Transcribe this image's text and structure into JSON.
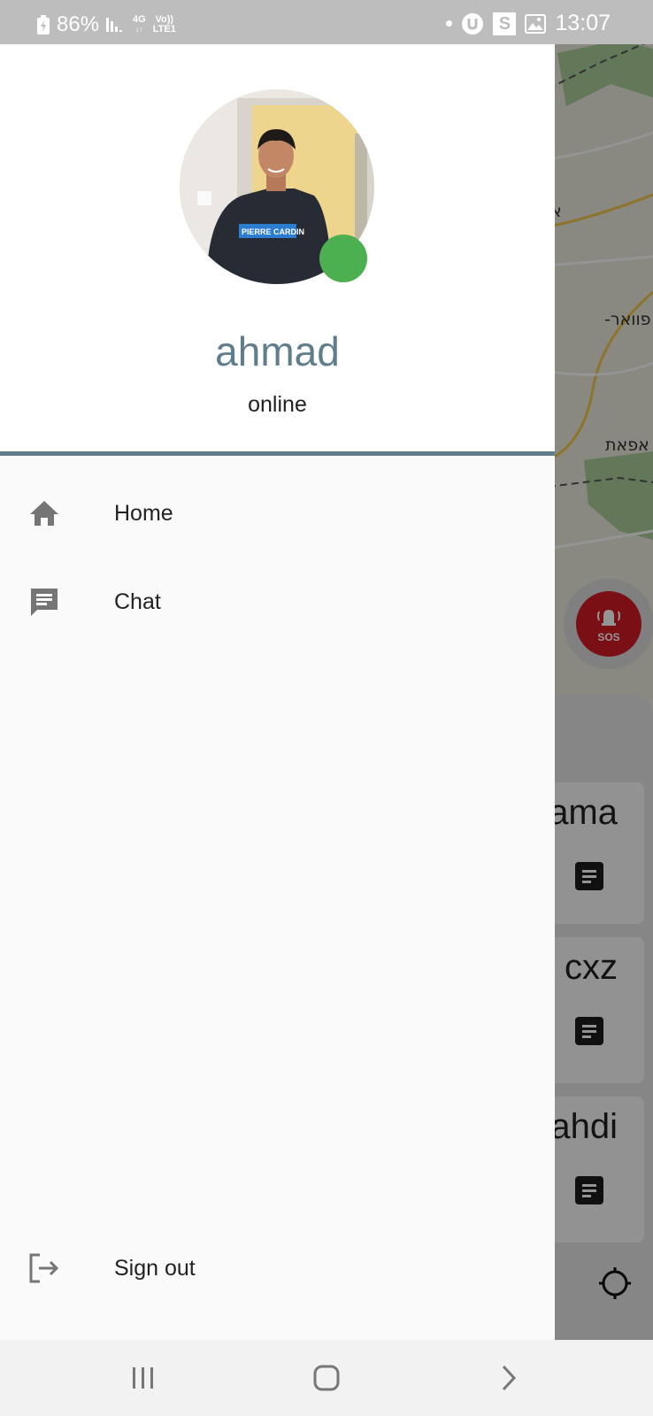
{
  "status_bar": {
    "battery_percent": "86%",
    "network": "4G",
    "volte": "Vo))",
    "lte": "LTE1",
    "time": "13:07",
    "icons": [
      "battery-charging-icon",
      "signal-icon",
      "dot-icon",
      "vpn-icon",
      "s-app-icon",
      "gallery-icon"
    ]
  },
  "drawer": {
    "user": {
      "name": "ahmad",
      "status": "online",
      "status_color": "#4caf50"
    },
    "items": [
      {
        "label": "Home",
        "icon": "home-icon"
      },
      {
        "label": "Chat",
        "icon": "chat-icon"
      }
    ],
    "sign_out": {
      "label": "Sign out",
      "icon": "sign-out-icon"
    },
    "accent_color": "#607d8b"
  },
  "background_app": {
    "map_labels": [
      "א",
      "-פוואר",
      "אפאת"
    ],
    "sos_label": "SOS",
    "cards": [
      {
        "name": "ama"
      },
      {
        "name": "cxz"
      },
      {
        "name": "ahdi"
      }
    ]
  },
  "nav_bar": {
    "buttons": [
      "recent-apps-icon",
      "home-button-icon",
      "back-icon"
    ]
  }
}
